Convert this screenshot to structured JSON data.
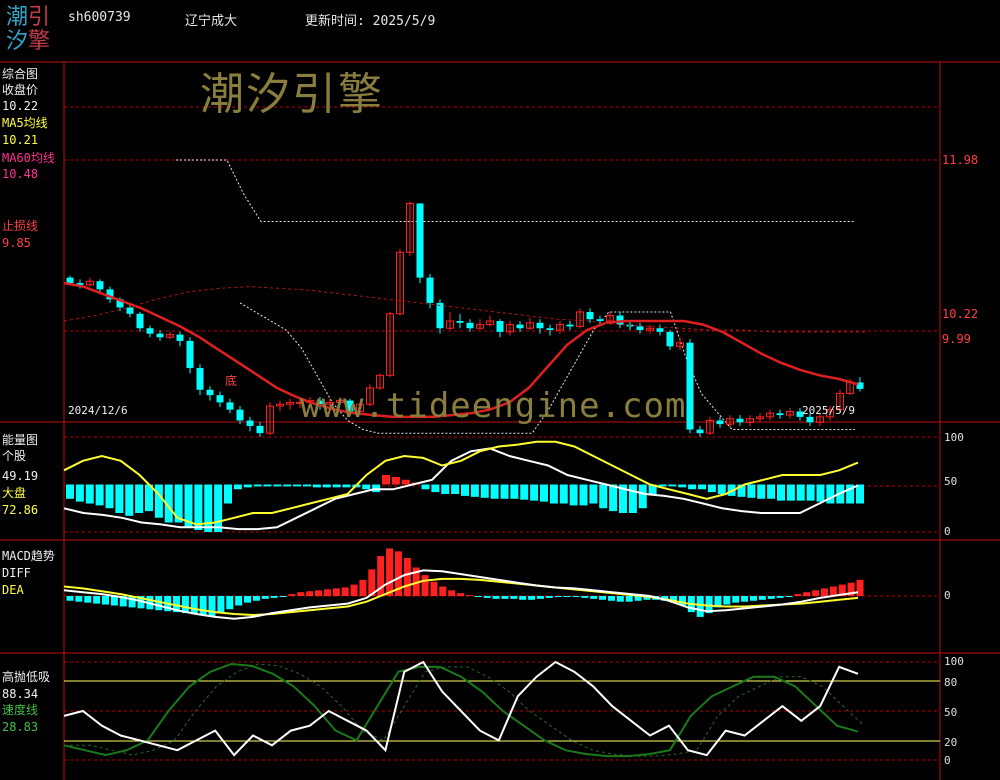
{
  "header": {
    "logo_chars": [
      "潮",
      "引",
      "汐",
      "擎"
    ],
    "code": "sh600739",
    "name": "辽宁成大",
    "update": "更新时间: 2025/5/9"
  },
  "watermark": {
    "brand": "潮汐引擎",
    "url": "www.tideengine.com"
  },
  "main_panel": {
    "title": "综合图",
    "close_label": "收盘价",
    "close_value": "10.22",
    "ma5_label": "MA5均线",
    "ma5_value": "10.21",
    "ma60_label": "MA60均线",
    "ma60_value": "10.48",
    "stop_label": "止损线",
    "stop_value": "9.85",
    "bottom_marker": "底",
    "start_date": "2024/12/6",
    "end_date": "2025/5/9",
    "right_labels": [
      "11.98",
      "10.22",
      "9.99"
    ]
  },
  "energy_panel": {
    "title": "能量图",
    "stock_label": "个股",
    "stock_value": "49.19",
    "market_label": "大盘",
    "market_value": "72.86",
    "ticks": [
      "100",
      "50",
      "0"
    ]
  },
  "macd_panel": {
    "title": "MACD趋势",
    "diff_label": "DIFF",
    "dea_label": "DEA",
    "ticks": [
      "0"
    ]
  },
  "osc_panel": {
    "title": "高抛低吸",
    "value1": "88.34",
    "speed_label": "速度线",
    "speed_value": "28.83",
    "ticks": [
      "100",
      "80",
      "50",
      "20",
      "0"
    ]
  },
  "colors": {
    "up": "#ff2020",
    "down": "#00ffff",
    "ma": "#e02020",
    "guide": "#c00000",
    "white": "#ffffff",
    "yellow": "#ffff30",
    "green": "#1a7a1a",
    "watermark": "#8a7e3c"
  },
  "chart_data": [
    {
      "type": "candlestick",
      "price_labels": [
        11.98,
        10.22,
        9.99
      ],
      "candles": [
        [
          10.68,
          10.62,
          10.7,
          10.6
        ],
        [
          10.62,
          10.6,
          10.66,
          10.56
        ],
        [
          10.6,
          10.64,
          10.68,
          10.58
        ],
        [
          10.64,
          10.55,
          10.66,
          10.5
        ],
        [
          10.55,
          10.44,
          10.58,
          10.4
        ],
        [
          10.44,
          10.35,
          10.46,
          10.31
        ],
        [
          10.35,
          10.28,
          10.38,
          10.24
        ],
        [
          10.28,
          10.12,
          10.3,
          10.08
        ],
        [
          10.12,
          10.06,
          10.15,
          10.02
        ],
        [
          10.06,
          10.02,
          10.1,
          9.98
        ],
        [
          10.02,
          10.05,
          10.08,
          10.0
        ],
        [
          10.05,
          9.98,
          10.08,
          9.92
        ],
        [
          9.98,
          9.68,
          10.02,
          9.62
        ],
        [
          9.68,
          9.44,
          9.72,
          9.38
        ],
        [
          9.44,
          9.38,
          9.48,
          9.32
        ],
        [
          9.38,
          9.3,
          9.42,
          9.25
        ],
        [
          9.3,
          9.22,
          9.34,
          9.18
        ],
        [
          9.22,
          9.1,
          9.26,
          9.06
        ],
        [
          9.1,
          9.04,
          9.14,
          8.98
        ],
        [
          9.04,
          8.96,
          9.08,
          8.92
        ],
        [
          8.96,
          9.26,
          9.3,
          8.94
        ],
        [
          9.26,
          9.28,
          9.32,
          9.2
        ],
        [
          9.28,
          9.3,
          9.34,
          9.22
        ],
        [
          9.3,
          9.3,
          9.34,
          9.24
        ],
        [
          9.3,
          9.32,
          9.36,
          9.26
        ],
        [
          9.32,
          9.28,
          9.36,
          9.22
        ],
        [
          9.28,
          9.3,
          9.34,
          9.22
        ],
        [
          9.3,
          9.32,
          9.36,
          9.26
        ],
        [
          9.32,
          9.2,
          9.34,
          9.16
        ],
        [
          9.2,
          9.28,
          9.3,
          9.16
        ],
        [
          9.28,
          9.46,
          9.5,
          9.26
        ],
        [
          9.46,
          9.6,
          9.62,
          9.44
        ],
        [
          9.6,
          10.28,
          10.3,
          9.58
        ],
        [
          10.28,
          10.96,
          11.0,
          10.26
        ],
        [
          10.96,
          11.5,
          11.52,
          10.92
        ],
        [
          11.5,
          10.68,
          11.5,
          10.62
        ],
        [
          10.68,
          10.4,
          10.72,
          10.34
        ],
        [
          10.4,
          10.12,
          10.44,
          10.06
        ],
        [
          10.12,
          10.2,
          10.3,
          10.1
        ],
        [
          10.2,
          10.18,
          10.28,
          10.12
        ],
        [
          10.18,
          10.12,
          10.22,
          10.08
        ],
        [
          10.12,
          10.16,
          10.22,
          10.1
        ],
        [
          10.16,
          10.2,
          10.26,
          10.14
        ],
        [
          10.2,
          10.08,
          10.22,
          10.02
        ],
        [
          10.08,
          10.16,
          10.2,
          10.04
        ],
        [
          10.16,
          10.12,
          10.2,
          10.08
        ],
        [
          10.12,
          10.18,
          10.24,
          10.1
        ],
        [
          10.18,
          10.12,
          10.22,
          10.06
        ],
        [
          10.12,
          10.1,
          10.16,
          10.04
        ],
        [
          10.1,
          10.16,
          10.2,
          10.06
        ],
        [
          10.16,
          10.14,
          10.2,
          10.1
        ],
        [
          10.14,
          10.3,
          10.34,
          10.12
        ],
        [
          10.3,
          10.22,
          10.34,
          10.18
        ],
        [
          10.22,
          10.2,
          10.26,
          10.16
        ],
        [
          10.2,
          10.26,
          10.3,
          10.16
        ],
        [
          10.26,
          10.16,
          10.3,
          10.12
        ],
        [
          10.16,
          10.14,
          10.2,
          10.1
        ],
        [
          10.14,
          10.1,
          10.18,
          10.06
        ],
        [
          10.1,
          10.12,
          10.16,
          10.06
        ],
        [
          10.12,
          10.08,
          10.16,
          10.04
        ],
        [
          10.08,
          9.92,
          10.1,
          9.88
        ],
        [
          9.92,
          9.96,
          10.02,
          9.88
        ],
        [
          9.96,
          9.0,
          10.0,
          8.96
        ],
        [
          9.0,
          8.96,
          9.04,
          8.92
        ],
        [
          8.96,
          9.1,
          9.14,
          8.94
        ],
        [
          9.1,
          9.06,
          9.14,
          9.02
        ],
        [
          9.06,
          9.12,
          9.16,
          9.02
        ],
        [
          9.12,
          9.08,
          9.16,
          9.04
        ],
        [
          9.08,
          9.12,
          9.16,
          9.04
        ],
        [
          9.12,
          9.14,
          9.18,
          9.08
        ],
        [
          9.14,
          9.18,
          9.22,
          9.1
        ],
        [
          9.18,
          9.16,
          9.22,
          9.12
        ],
        [
          9.16,
          9.2,
          9.24,
          9.12
        ],
        [
          9.2,
          9.14,
          9.24,
          9.1
        ],
        [
          9.14,
          9.08,
          9.18,
          9.04
        ],
        [
          9.08,
          9.14,
          9.18,
          9.04
        ],
        [
          9.14,
          9.22,
          9.26,
          9.1
        ],
        [
          9.22,
          9.4,
          9.44,
          9.2
        ],
        [
          9.4,
          9.52,
          9.56,
          9.38
        ],
        [
          9.52,
          9.45,
          9.58,
          9.42
        ]
      ],
      "ma_red": [
        10.62,
        10.58,
        10.5,
        10.42,
        10.34,
        10.24,
        10.14,
        10.02,
        9.88,
        9.74,
        9.6,
        9.46,
        9.36,
        9.28,
        9.22,
        9.18,
        9.16,
        9.14,
        9.14,
        9.14,
        9.16,
        9.18,
        9.22,
        9.3,
        9.46,
        9.7,
        9.94,
        10.1,
        10.18,
        10.2,
        10.2,
        10.2,
        10.2,
        10.16,
        10.08,
        9.96,
        9.84,
        9.74,
        9.66,
        9.6,
        9.56,
        9.5
      ],
      "ma_dashed": [
        10.2,
        10.26,
        10.34,
        10.44,
        10.52,
        10.56,
        10.58,
        10.56,
        10.54,
        10.5,
        10.46,
        10.42,
        10.38,
        10.34,
        10.3,
        10.26,
        10.22,
        10.2,
        10.16,
        10.14,
        10.12,
        10.1,
        10.1,
        10.08,
        10.08,
        10.08,
        10.08
      ],
      "upper_band": [
        11.98,
        11.98,
        11.98,
        11.98,
        11.6,
        11.3,
        11.3,
        11.3,
        11.3,
        11.3,
        11.3,
        11.3,
        11.3,
        11.3,
        11.3,
        11.3,
        11.3,
        11.3,
        11.3,
        11.3,
        11.3,
        11.3,
        11.3,
        11.3,
        11.3,
        11.3,
        11.3,
        11.3,
        11.3,
        11.3,
        11.3,
        11.3,
        11.3,
        11.3,
        11.3,
        11.3,
        11.3,
        11.3,
        11.3,
        11.3,
        11.3
      ],
      "lower_band": [
        10.4,
        10.3,
        10.2,
        10.1,
        9.9,
        9.6,
        9.3,
        9.1,
        9.0,
        8.96,
        8.96,
        8.96,
        8.96,
        8.96,
        8.96,
        8.96,
        8.96,
        8.96,
        8.96,
        8.96,
        9.2,
        9.5,
        9.8,
        10.1,
        10.3,
        10.3,
        10.3,
        10.3,
        10.3,
        9.8,
        9.4,
        9.2,
        9.0,
        9.0,
        9.0,
        9.0,
        9.0,
        9.0,
        9.0,
        9.0,
        9.0
      ]
    },
    {
      "type": "bar+line",
      "ylim": [
        0,
        100
      ],
      "bars": [
        -15,
        -18,
        -20,
        -22,
        -25,
        -30,
        -33,
        -30,
        -28,
        -35,
        -40,
        -40,
        -45,
        -48,
        -50,
        -50,
        -20,
        -5,
        -3,
        -2,
        -2,
        -2,
        -2,
        -2,
        -2,
        -3,
        -3,
        -3,
        -3,
        -3,
        -5,
        -8,
        10,
        8,
        5,
        2,
        -5,
        -8,
        -10,
        -10,
        -12,
        -13,
        -14,
        -15,
        -15,
        -15,
        -16,
        -17,
        -18,
        -20,
        -20,
        -22,
        -22,
        -20,
        -25,
        -28,
        -30,
        -30,
        -25,
        -10,
        -2,
        -2,
        -3,
        -5,
        -5,
        -8,
        -10,
        -12,
        -13,
        -14,
        -15,
        -15,
        -17,
        -17,
        -17,
        -17,
        -18,
        -20,
        -20,
        -20,
        -20
      ],
      "series": [
        {
          "name": "个股",
          "values": [
            25,
            20,
            18,
            15,
            10,
            8,
            5,
            5,
            5,
            3,
            3,
            5,
            15,
            25,
            35,
            40,
            45,
            45,
            50,
            55,
            75,
            85,
            88,
            80,
            75,
            70,
            60,
            55,
            50,
            45,
            40,
            38,
            35,
            30,
            25,
            22,
            20,
            20,
            20,
            30,
            40,
            49
          ]
        },
        {
          "name": "大盘",
          "values": [
            65,
            75,
            80,
            75,
            60,
            40,
            15,
            8,
            10,
            15,
            20,
            20,
            25,
            30,
            35,
            40,
            60,
            75,
            80,
            78,
            70,
            75,
            85,
            90,
            92,
            95,
            95,
            90,
            80,
            70,
            60,
            50,
            45,
            40,
            35,
            40,
            50,
            55,
            60,
            60,
            60,
            65,
            73
          ]
        }
      ]
    },
    {
      "type": "bar+line",
      "bars": [
        -0.05,
        -0.06,
        -0.07,
        -0.08,
        -0.09,
        -0.1,
        -0.11,
        -0.12,
        -0.13,
        -0.14,
        -0.15,
        -0.16,
        -0.17,
        -0.18,
        -0.19,
        -0.2,
        -0.21,
        -0.18,
        -0.14,
        -0.1,
        -0.07,
        -0.05,
        -0.03,
        -0.02,
        -0.01,
        0.02,
        0.04,
        0.05,
        0.06,
        0.07,
        0.08,
        0.09,
        0.12,
        0.17,
        0.28,
        0.42,
        0.5,
        0.47,
        0.4,
        0.3,
        0.22,
        0.15,
        0.1,
        0.06,
        0.03,
        0.01,
        -0.01,
        -0.02,
        -0.03,
        -0.03,
        -0.03,
        -0.04,
        -0.04,
        -0.03,
        -0.02,
        -0.01,
        -0.01,
        -0.01,
        -0.02,
        -0.03,
        -0.04,
        -0.05,
        -0.06,
        -0.06,
        -0.05,
        -0.04,
        -0.04,
        -0.05,
        -0.07,
        -0.1,
        -0.17,
        -0.22,
        -0.18,
        -0.12,
        -0.09,
        -0.07,
        -0.06,
        -0.05,
        -0.04,
        -0.03,
        -0.02,
        -0.01,
        0.02,
        0.04,
        0.06,
        0.08,
        0.1,
        0.12,
        0.14,
        0.17
      ],
      "series": [
        {
          "name": "DIFF",
          "values": [
            0.06,
            0.04,
            0.02,
            -0.01,
            -0.05,
            -0.1,
            -0.15,
            -0.19,
            -0.22,
            -0.24,
            -0.22,
            -0.18,
            -0.15,
            -0.12,
            -0.1,
            -0.08,
            -0.02,
            0.12,
            0.22,
            0.27,
            0.26,
            0.23,
            0.2,
            0.17,
            0.14,
            0.11,
            0.09,
            0.08,
            0.06,
            0.04,
            0.02,
            0.0,
            -0.05,
            -0.12,
            -0.16,
            -0.15,
            -0.13,
            -0.11,
            -0.09,
            -0.06,
            -0.02,
            0.01,
            0.04
          ]
        },
        {
          "name": "DEA",
          "values": [
            0.1,
            0.08,
            0.05,
            0.02,
            -0.02,
            -0.06,
            -0.1,
            -0.14,
            -0.17,
            -0.19,
            -0.2,
            -0.19,
            -0.17,
            -0.15,
            -0.13,
            -0.11,
            -0.06,
            0.02,
            0.1,
            0.16,
            0.18,
            0.18,
            0.17,
            0.15,
            0.13,
            0.11,
            0.09,
            0.07,
            0.05,
            0.03,
            0.01,
            -0.01,
            -0.04,
            -0.08,
            -0.1,
            -0.11,
            -0.11,
            -0.1,
            -0.09,
            -0.08,
            -0.06,
            -0.04,
            -0.02
          ]
        }
      ]
    },
    {
      "type": "line",
      "ylim": [
        0,
        100
      ],
      "series": [
        {
          "name": "高抛低吸",
          "values": [
            45,
            50,
            35,
            25,
            20,
            15,
            10,
            20,
            30,
            5,
            25,
            15,
            30,
            35,
            50,
            40,
            30,
            10,
            90,
            100,
            70,
            50,
            30,
            20,
            65,
            85,
            100,
            90,
            75,
            55,
            40,
            25,
            35,
            10,
            5,
            30,
            25,
            40,
            55,
            40,
            55,
            95,
            88
          ]
        },
        {
          "name": "速度线",
          "values": [
            15,
            10,
            5,
            10,
            20,
            50,
            75,
            90,
            98,
            96,
            88,
            75,
            55,
            30,
            20,
            55,
            90,
            95,
            95,
            85,
            70,
            50,
            35,
            20,
            10,
            6,
            4,
            4,
            6,
            10,
            45,
            65,
            75,
            85,
            85,
            75,
            55,
            35,
            29
          ]
        }
      ]
    }
  ]
}
